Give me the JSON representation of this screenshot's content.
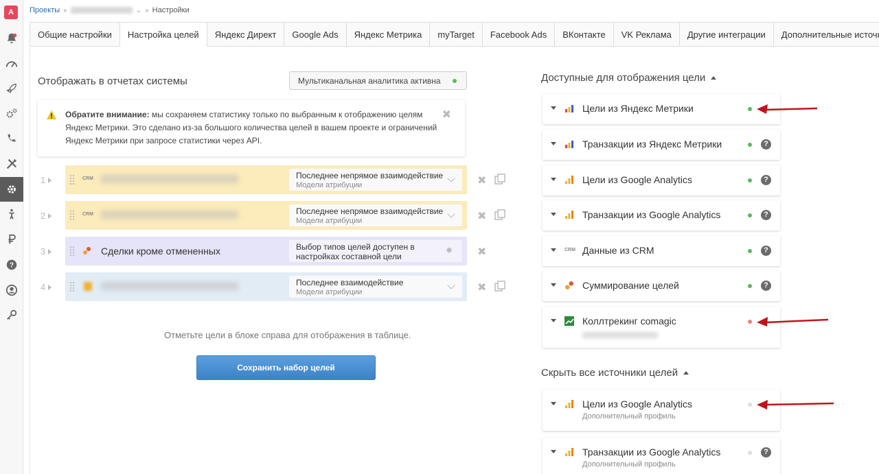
{
  "sidebar": {
    "logo": "A",
    "items": [
      {
        "icon": "bell-icon"
      },
      {
        "icon": "speedometer-icon"
      },
      {
        "icon": "rocket-icon"
      },
      {
        "icon": "gears-icon"
      },
      {
        "icon": "phone-icon"
      },
      {
        "icon": "tools-icon"
      },
      {
        "icon": "gear-icon",
        "active": true
      },
      {
        "icon": "person-icon"
      },
      {
        "icon": "ruble-icon"
      },
      {
        "icon": "question-icon"
      },
      {
        "icon": "user-circle-icon"
      },
      {
        "icon": "key-icon"
      }
    ]
  },
  "breadcrumb": {
    "projects": "Проекты",
    "current": "Настройки"
  },
  "tabs": [
    {
      "label": "Общие настройки"
    },
    {
      "label": "Настройка целей",
      "active": true
    },
    {
      "label": "Яндекс Директ"
    },
    {
      "label": "Google Ads"
    },
    {
      "label": "Яндекс Метрика"
    },
    {
      "label": "myTarget"
    },
    {
      "label": "Facebook Ads"
    },
    {
      "label": "ВКонтакте"
    },
    {
      "label": "VK Реклама"
    },
    {
      "label": "Другие интеграции"
    },
    {
      "label": "Дополнительные источники"
    }
  ],
  "left": {
    "title": "Отображать в отчетах системы",
    "multichannel": "Мультиканальная аналитика активна",
    "notice": {
      "bold": "Обратите внимание:",
      "text": " мы сохраняем статистику только по выбранным к отображению целям Яндекс Метрики. Это сделано из-за большого количества целей в вашем проекте и ограничений Яндекс Метрики при запросе статистики через API."
    },
    "rows": [
      {
        "num": "1",
        "attr": "Последнее непрямое взаимодействие",
        "attr_sub": "Модели атрибуции"
      },
      {
        "num": "2",
        "attr": "Последнее непрямое взаимодействие",
        "attr_sub": "Модели атрибуции"
      },
      {
        "num": "3",
        "label": "Сделки кроме отмененных",
        "attr": "Выбор типов целей доступен в настройках составной цели"
      },
      {
        "num": "4",
        "attr": "Последнее взаимодействие",
        "attr_sub": "Модели атрибуции"
      }
    ],
    "hint": "Отметьте цели в блоке справа для отображения в таблице.",
    "save": "Сохранить набор целей"
  },
  "right": {
    "available_title": "Доступные для отображения цели",
    "hide_title": "Скрыть все источники целей",
    "sources": [
      {
        "name": "Цели из Яндекс Метрики",
        "status": "active"
      },
      {
        "name": "Транзакции из Яндекс Метрики",
        "status": "active"
      },
      {
        "name": "Цели из Google Analytics",
        "status": "active"
      },
      {
        "name": "Транзакции из Google Analytics",
        "status": "active"
      },
      {
        "name": "Данные из CRM",
        "status": "active"
      },
      {
        "name": "Суммирование целей",
        "status": "active"
      },
      {
        "name": "Коллтрекинг comagic",
        "status": "error"
      }
    ],
    "extra_sources": [
      {
        "name": "Цели из Google Analytics",
        "sub": "Дополнительный профиль",
        "status": "inactive"
      },
      {
        "name": "Транзакции из Google Analytics",
        "sub": "Дополнительный профиль",
        "status": "inactive"
      }
    ]
  },
  "colors": {
    "active": "#5cb85c",
    "error": "#f08080",
    "inactive": "#dddddd",
    "arrow": "#c0141c",
    "button": "#4b90d4"
  }
}
